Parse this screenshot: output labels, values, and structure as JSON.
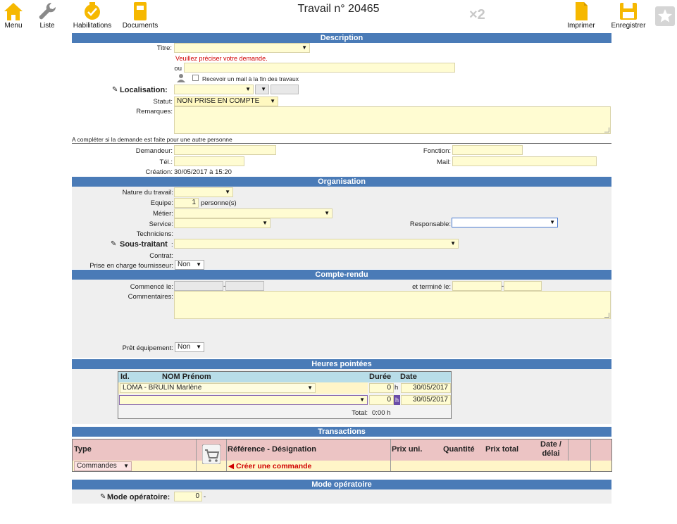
{
  "toolbar": {
    "menu": "Menu",
    "liste": "Liste",
    "habilitations": "Habilitations",
    "documents": "Documents",
    "imprimer": "Imprimer",
    "enregistrer": "Enregistrer",
    "multiplier": "×2"
  },
  "page_title": "Travail n° 20465",
  "description": {
    "header": "Description",
    "titre_label": "Titre:",
    "titre_value": "",
    "titre_hint": "Veuillez préciser votre demande.",
    "ou_label": "ou",
    "ou_value": "",
    "mail_checkbox_label": "Recevoir un mail à la fin des travaux",
    "localisation_label": "Localisation:",
    "statut_label": "Statut:",
    "statut_value": "NON PRISE EN COMPTE",
    "remarques_label": "Remarques:",
    "autre_personne_note": "A compléter si la demande est faite pour une autre personne",
    "demandeur_label": "Demandeur:",
    "fonction_label": "Fonction:",
    "tel_label": "Tél.:",
    "mail_label": "Mail:",
    "creation_label": "Création:",
    "creation_value": "30/05/2017 à 15:20"
  },
  "organisation": {
    "header": "Organisation",
    "nature_label": "Nature du travail:",
    "equipe_label": "Equipe:",
    "equipe_value": "1",
    "equipe_unit": "personne(s)",
    "metier_label": "Métier:",
    "service_label": "Service:",
    "responsable_label": "Responsable:",
    "techniciens_label": "Techniciens:",
    "sous_traitant_label": "Sous-traitant",
    "sous_traitant_colon": ":",
    "contrat_label": "Contrat:",
    "prise_en_charge_label": "Prise en charge fournisseur:",
    "prise_en_charge_value": "Non"
  },
  "compte_rendu": {
    "header": "Compte-rendu",
    "commence_label": "Commencé le:",
    "termine_label": "et terminé le:",
    "dash": "-",
    "commentaires_label": "Commentaires:",
    "pret_label": "Prêt équipement:",
    "pret_value": "Non"
  },
  "heures": {
    "header": "Heures pointées",
    "col_id": "Id.",
    "col_nom": "NOM Prénom",
    "col_duree": "Durée",
    "col_date": "Date",
    "rows": [
      {
        "nom": "LOMA - BRULIN Marlène",
        "duree": "0",
        "unit": "h",
        "date": "30/05/2017"
      },
      {
        "nom": "",
        "duree": "0",
        "unit": "h",
        "date": "30/05/2017"
      }
    ],
    "total_label": "Total:",
    "total_value": "0:00 h"
  },
  "transactions": {
    "header": "Transactions",
    "col_type": "Type",
    "col_ref": "Référence - Désignation",
    "col_prix_uni": "Prix uni.",
    "col_quantite": "Quantité",
    "col_prix_total": "Prix total",
    "col_date": "Date / délai",
    "type_value": "Commandes",
    "create_order": "Créer une commande"
  },
  "mode_operatoire": {
    "header": "Mode opératoire",
    "label": "Mode opératoire:",
    "value": "0",
    "dash": "-"
  }
}
